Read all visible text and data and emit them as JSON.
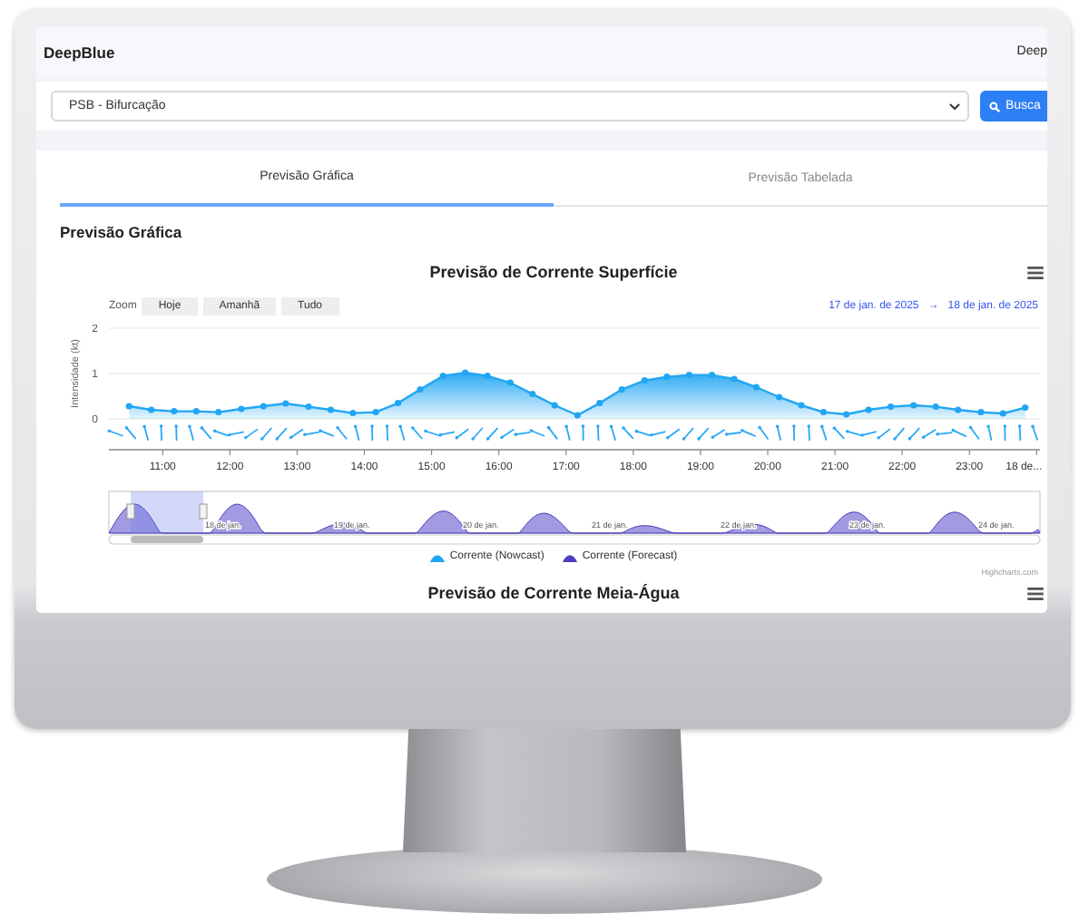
{
  "header": {
    "brand": "DeepBlue",
    "user": "Deep"
  },
  "search": {
    "value": "PSB - Bifurcação",
    "button": "Busca"
  },
  "tabs": [
    {
      "label": "Previsão Gráfica",
      "selected": true
    },
    {
      "label": "Previsão Tabelada",
      "selected": false
    }
  ],
  "section_title": "Previsão Gráfica",
  "charts": [
    {
      "title": "Previsão de Corrente Superfície",
      "zoom_label": "Zoom",
      "zoom_buttons": [
        "Hoje",
        "Amanhã",
        "Tudo"
      ],
      "range_from": "17 de jan. de 2025",
      "range_arrow": "→",
      "range_to": "18 de jan. de 2025",
      "navigator_labels": [
        "18 de jan.",
        "19 de jan.",
        "20 de jan.",
        "21 de jan.",
        "22 de jan.",
        "23 de jan.",
        "24 de jan."
      ],
      "credits": "Highcharts.com",
      "chart_data": {
        "type": "area",
        "ylabel": "Intensidade (kt)",
        "x": [
          10.5,
          10.83,
          11.17,
          11.5,
          11.83,
          12.17,
          12.5,
          12.83,
          13.17,
          13.5,
          13.83,
          14.17,
          14.5,
          14.83,
          15.17,
          15.5,
          15.83,
          16.17,
          16.5,
          16.83,
          17.17,
          17.5,
          17.83,
          18.17,
          18.5,
          18.83,
          19.17,
          19.5,
          19.83,
          20.17,
          20.5,
          20.83,
          21.17,
          21.5,
          21.83,
          22.17,
          22.5,
          22.83,
          23.17,
          23.5,
          23.83
        ],
        "series": [
          {
            "name": "Corrente (Nowcast)",
            "color": "#21a6f3",
            "values": [
              0.28,
              0.2,
              0.17,
              0.17,
              0.15,
              0.22,
              0.28,
              0.34,
              0.27,
              0.2,
              0.13,
              0.15,
              0.35,
              0.65,
              0.95,
              1.02,
              0.95,
              0.8,
              0.55,
              0.3,
              0.08,
              0.35,
              0.65,
              0.85,
              0.93,
              0.97,
              0.97,
              0.88,
              0.7,
              0.48,
              0.3,
              0.15,
              0.1,
              0.2,
              0.27,
              0.3,
              0.27,
              0.2,
              0.15,
              0.12,
              0.25
            ]
          },
          {
            "name": "Corrente (Forecast)",
            "color": "#4b3fc0",
            "values": [
              null,
              null,
              null,
              null,
              null,
              null,
              null,
              null,
              null,
              null,
              null,
              null,
              null,
              null,
              null,
              null,
              null,
              null,
              null,
              null,
              null,
              null,
              null,
              null,
              null,
              null,
              null,
              null,
              null,
              null,
              null,
              null,
              null,
              null,
              null,
              null,
              null,
              null,
              null,
              null,
              null
            ]
          }
        ],
        "xlim": [
          10.2,
          24.05
        ],
        "ylim": [
          0,
          2
        ],
        "xticks": [
          {
            "value": 11,
            "label": "11:00"
          },
          {
            "value": 12,
            "label": "12:00"
          },
          {
            "value": 13,
            "label": "13:00"
          },
          {
            "value": 14,
            "label": "14:00"
          },
          {
            "value": 15,
            "label": "15:00"
          },
          {
            "value": 16,
            "label": "16:00"
          },
          {
            "value": 17,
            "label": "17:00"
          },
          {
            "value": 18,
            "label": "18:00"
          },
          {
            "value": 19,
            "label": "19:00"
          },
          {
            "value": 20,
            "label": "20:00"
          },
          {
            "value": 21,
            "label": "21:00"
          },
          {
            "value": 22,
            "label": "22:00"
          },
          {
            "value": 23,
            "label": "23:00"
          },
          {
            "value": 24,
            "label": "18 de..."
          }
        ],
        "yticks": [
          0,
          1,
          2
        ]
      }
    },
    {
      "title": "Previsão de Corrente Meia-Água"
    }
  ]
}
